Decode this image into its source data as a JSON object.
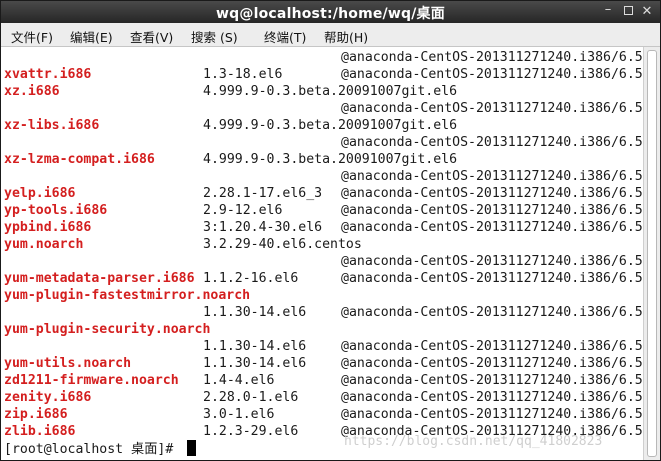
{
  "window": {
    "title": "wq@localhost:/home/wq/桌面",
    "minimize_glyph": "–",
    "close_glyph": "✕"
  },
  "menu": [
    {
      "label": "文件(F)"
    },
    {
      "label": "编辑(E)"
    },
    {
      "label": "查看(V)"
    },
    {
      "label": "搜索 (S)"
    },
    {
      "label": "终端(T)"
    },
    {
      "label": "帮助(H)"
    }
  ],
  "terminal": {
    "lines": [
      {
        "pkg": "",
        "ver": "",
        "repo": "@anaconda-CentOS-201311271240.i386/6.5"
      },
      {
        "pkg": "xvattr.i686",
        "ver": "1.3-18.el6",
        "repo": "@anaconda-CentOS-201311271240.i386/6.5"
      },
      {
        "pkg": "xz.i686",
        "ver": "4.999.9-0.3.beta.20091007git.el6",
        "repo": ""
      },
      {
        "pkg": "",
        "ver": "",
        "repo": "@anaconda-CentOS-201311271240.i386/6.5"
      },
      {
        "pkg": "xz-libs.i686",
        "ver": "4.999.9-0.3.beta.20091007git.el6",
        "repo": ""
      },
      {
        "pkg": "",
        "ver": "",
        "repo": "@anaconda-CentOS-201311271240.i386/6.5"
      },
      {
        "pkg": "xz-lzma-compat.i686",
        "ver": "4.999.9-0.3.beta.20091007git.el6",
        "repo": ""
      },
      {
        "pkg": "",
        "ver": "",
        "repo": "@anaconda-CentOS-201311271240.i386/6.5"
      },
      {
        "pkg": "yelp.i686",
        "ver": "2.28.1-17.el6_3",
        "repo": "@anaconda-CentOS-201311271240.i386/6.5"
      },
      {
        "pkg": "yp-tools.i686",
        "ver": "2.9-12.el6",
        "repo": "@anaconda-CentOS-201311271240.i386/6.5"
      },
      {
        "pkg": "ypbind.i686",
        "ver": "3:1.20.4-30.el6",
        "repo": "@anaconda-CentOS-201311271240.i386/6.5"
      },
      {
        "pkg": "yum.noarch",
        "ver": "3.2.29-40.el6.centos",
        "repo": ""
      },
      {
        "pkg": "",
        "ver": "",
        "repo": "@anaconda-CentOS-201311271240.i386/6.5"
      },
      {
        "pkg": "yum-metadata-parser.i686",
        "ver": "1.1.2-16.el6",
        "repo": "@anaconda-CentOS-201311271240.i386/6.5"
      },
      {
        "pkg": "yum-plugin-fastestmirror.noarch",
        "ver": "",
        "repo": ""
      },
      {
        "pkg": "",
        "ver": "1.1.30-14.el6",
        "repo": "@anaconda-CentOS-201311271240.i386/6.5"
      },
      {
        "pkg": "yum-plugin-security.noarch",
        "ver": "",
        "repo": ""
      },
      {
        "pkg": "",
        "ver": "1.1.30-14.el6",
        "repo": "@anaconda-CentOS-201311271240.i386/6.5"
      },
      {
        "pkg": "yum-utils.noarch",
        "ver": "1.1.30-14.el6",
        "repo": "@anaconda-CentOS-201311271240.i386/6.5"
      },
      {
        "pkg": "zd1211-firmware.noarch",
        "ver": "1.4-4.el6",
        "repo": "@anaconda-CentOS-201311271240.i386/6.5"
      },
      {
        "pkg": "zenity.i686",
        "ver": "2.28.0-1.el6",
        "repo": "@anaconda-CentOS-201311271240.i386/6.5"
      },
      {
        "pkg": "zip.i686",
        "ver": "3.0-1.el6",
        "repo": "@anaconda-CentOS-201311271240.i386/6.5"
      },
      {
        "pkg": "zlib.i686",
        "ver": "1.2.3-29.el6",
        "repo": "@anaconda-CentOS-201311271240.i386/6.5"
      }
    ],
    "prompt": "[root@localhost 桌面]# ",
    "watermark": "https://blog.csdn.net/qq_41802823"
  },
  "colors": {
    "package_name": "#d41f1f",
    "text": "#1a1a1a",
    "background": "#ffffff",
    "titlebar": "#2f2f2f"
  }
}
